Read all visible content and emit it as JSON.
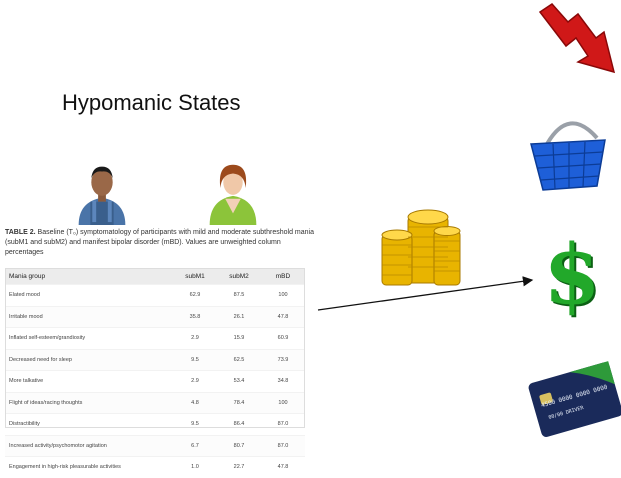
{
  "slide": {
    "title": "Hypomanic States"
  },
  "caption": {
    "prefix": "TABLE 2.",
    "text": " Baseline (T₀) symptomatology of participants with mild and moderate subthreshold mania (subM1 and subM2) and manifest bipolar disorder (mBD). Values are unweighted column percentages"
  },
  "table": {
    "headers": [
      "Mania group",
      "subM1",
      "subM2",
      "mBD"
    ],
    "rows": [
      [
        "Elated mood",
        "62.9",
        "87.5",
        "100"
      ],
      [
        "Irritable mood",
        "35.8",
        "26.1",
        "47.8"
      ],
      [
        "Inflated self-esteem/grandiosity",
        "2.9",
        "15.9",
        "60.9"
      ],
      [
        "Decreased need for sleep",
        "9.5",
        "62.5",
        "73.9"
      ],
      [
        "More talkative",
        "2.9",
        "53.4",
        "34.8"
      ],
      [
        "Flight of ideas/racing thoughts",
        "4.8",
        "78.4",
        "100"
      ],
      [
        "Distractibility",
        "9.5",
        "86.4",
        "87.0"
      ],
      [
        "Increased activity/psychomotor agitation",
        "6.7",
        "80.7",
        "87.0"
      ],
      [
        "Engagement in high-risk pleasurable activities",
        "1.0",
        "22.7",
        "47.8"
      ]
    ]
  },
  "icons": {
    "man": "man-avatar-icon",
    "woman": "woman-avatar-icon",
    "coins": "gold-coins-icon",
    "down_arrow": "red-down-trend-arrow-icon",
    "basket": "blue-shopping-basket-icon",
    "dollar": "green-dollar-sign-icon",
    "card": "credit-card-icon"
  },
  "card": {
    "number_a": "4500",
    "number_b": "0000",
    "number_c": "0000",
    "number_d": "0000",
    "date": "00/00",
    "owner": "DRIVER"
  },
  "colors": {
    "gold": "#e8b400",
    "red": "#d01818",
    "blue": "#1e5fd8",
    "green": "#22a82a"
  }
}
